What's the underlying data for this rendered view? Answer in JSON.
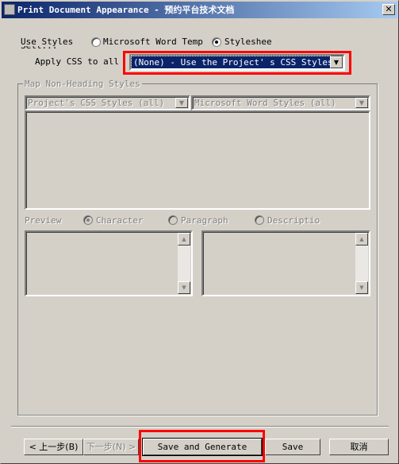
{
  "title": "Print Document Appearance - 预约平台技术文档",
  "use_styles_label": "Use Styles",
  "use_styles_label_line2": "Sett...",
  "radio_word": "Microsoft Word Templ:",
  "radio_stylesheet": "Stylesheet",
  "apply_css_label": "Apply CSS to all",
  "apply_css_value": "(None) - Use the Project' s CSS Styles",
  "group_title": "Map Non-Heading Styles",
  "left_combo": "Project's CSS Styles (all)",
  "right_combo": "Microsoft Word Styles (all)",
  "preview_label": "Preview",
  "preview_options": [
    "Character",
    "Paragraph",
    "Descriptio"
  ],
  "buttons": {
    "back": "< 上一步(B)",
    "next": "下一步(N) >",
    "save_generate": "Save and Generate",
    "save": "Save",
    "cancel": "取消"
  }
}
